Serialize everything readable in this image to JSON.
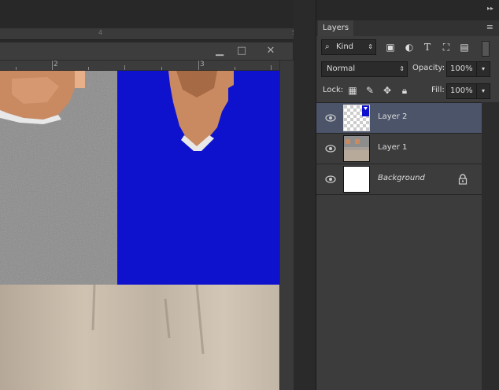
{
  "top_ruler": {
    "marks": [
      "4",
      "5"
    ]
  },
  "doc_ruler": {
    "marks": [
      "2",
      "3"
    ]
  },
  "window_buttons": {
    "minimize": "▁",
    "maximize": "□",
    "close": "✕"
  },
  "panel": {
    "tab_label": "Layers",
    "menu_icon": "≡",
    "collapse_icon": "▸▸",
    "filter": {
      "kind": "Kind"
    },
    "blend_mode": "Normal",
    "opacity_label": "Opacity:",
    "opacity_value": "100%",
    "lock_label": "Lock:",
    "fill_label": "Fill:",
    "fill_value": "100%",
    "layers": [
      {
        "name": "Layer 2",
        "selected": true
      },
      {
        "name": "Layer 1",
        "selected": false
      },
      {
        "name": "Background",
        "selected": false,
        "locked": true
      }
    ]
  },
  "colors": {
    "accent_selected": "#4b5468",
    "canvas_blue": "#0f12cc"
  }
}
